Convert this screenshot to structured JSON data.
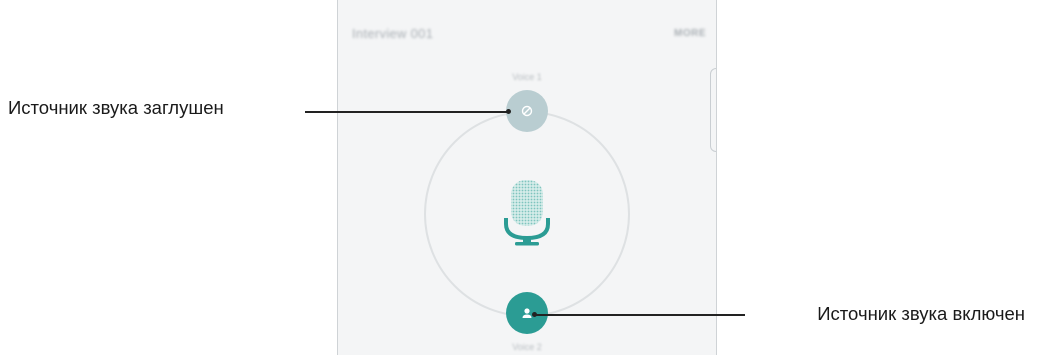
{
  "app": {
    "title": "Interview 001",
    "more_label": "MORE"
  },
  "sources": {
    "top_label": "Voice 1",
    "bottom_label": "Voice 2",
    "top_state": "muted",
    "bottom_state": "active"
  },
  "icons": {
    "muted": "mute-slash-icon",
    "active": "person-icon",
    "center": "microphone-icon"
  },
  "colors": {
    "active_teal": "#2b9c94",
    "muted_grey": "#b9cdd1",
    "ring": "#dee1e3",
    "mic_grid": "#7fc4be"
  },
  "callouts": {
    "muted": "Источник звука заглушен",
    "active": "Источник звука включен"
  }
}
